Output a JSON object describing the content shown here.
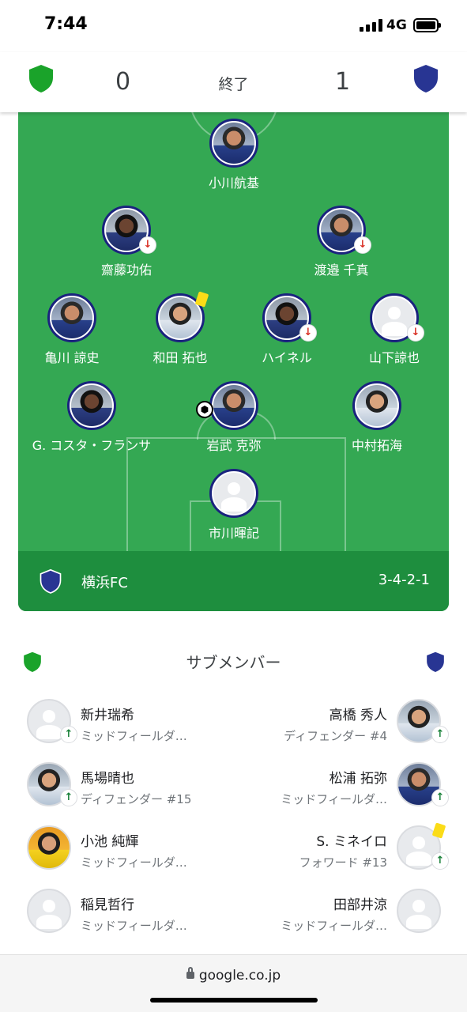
{
  "status_bar": {
    "time": "7:44",
    "network": "4G"
  },
  "score": {
    "home": "0",
    "away": "1",
    "state": "終了",
    "home_color": "#1aa32a",
    "away_color": "#283593"
  },
  "pitch": {
    "team_name": "横浜FC",
    "formation": "3-4-2-1",
    "players": [
      {
        "name": "小川航基",
        "avatar": "photo"
      },
      {
        "name": "齋藤功佑",
        "avatar": "photo",
        "event": "substituted-out"
      },
      {
        "name": "渡邉 千真",
        "avatar": "photo",
        "event": "substituted-out"
      },
      {
        "name": "亀川 諒史",
        "avatar": "photo"
      },
      {
        "name": "和田 拓也",
        "avatar": "photo",
        "event": "yellow-card"
      },
      {
        "name": "ハイネル",
        "avatar": "photo",
        "event": "substituted-out"
      },
      {
        "name": "山下諒也",
        "avatar": "placeholder",
        "event": "substituted-out"
      },
      {
        "name": "G. コスタ・フランサ",
        "avatar": "photo"
      },
      {
        "name": "岩武 克弥",
        "avatar": "photo",
        "event": "goal"
      },
      {
        "name": "中村拓海",
        "avatar": "photo"
      },
      {
        "name": "市川暉記",
        "avatar": "placeholder"
      }
    ]
  },
  "subs": {
    "title": "サブメンバー",
    "left": [
      {
        "name": "新井瑞希",
        "position": "ミッドフィールダ…",
        "avatar": "placeholder",
        "event": "substituted-in"
      },
      {
        "name": "馬場晴也",
        "position": "ディフェンダー #15",
        "avatar": "photo",
        "event": "substituted-in"
      },
      {
        "name": "小池 純輝",
        "position": "ミッドフィールダ…",
        "avatar": "photo"
      },
      {
        "name": "稲見哲行",
        "position": "ミッドフィールダ…",
        "avatar": "placeholder"
      }
    ],
    "right": [
      {
        "name": "高橋 秀人",
        "position": "ディフェンダー #4",
        "avatar": "photo",
        "event": "substituted-in"
      },
      {
        "name": "松浦 拓弥",
        "position": "ミッドフィールダ…",
        "avatar": "photo",
        "event": "substituted-in"
      },
      {
        "name": "S. ミネイロ",
        "position": "フォワード #13",
        "avatar": "placeholder",
        "event": "yellow-card"
      },
      {
        "name": "田部井涼",
        "position": "ミッドフィールダ…",
        "avatar": "placeholder"
      }
    ]
  },
  "browser": {
    "url": "google.co.jp"
  }
}
